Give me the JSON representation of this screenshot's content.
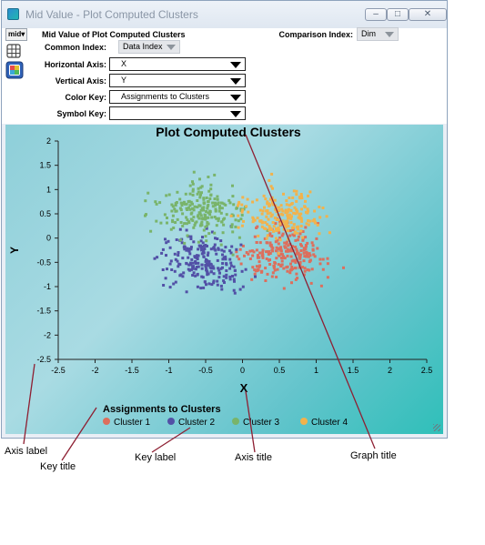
{
  "window": {
    "title": "Mid Value - Plot Computed Clusters",
    "buttons": [
      "–",
      "□",
      "✕"
    ]
  },
  "toolbar": {
    "mid_label": "mid▾",
    "header": "Mid Value of Plot Computed Clusters",
    "comparison_index_label": "Comparison Index:",
    "comparison_index_value": "Dim",
    "common_index_label": "Common Index:",
    "common_index_value": "Data Index",
    "horizontal_axis_label": "Horizontal Axis:",
    "horizontal_axis_value": "X",
    "vertical_axis_label": "Vertical Axis:",
    "vertical_axis_value": "Y",
    "color_key_label": "Color Key:",
    "color_key_value": "Assignments to Clusters",
    "symbol_key_label": "Symbol Key:",
    "symbol_key_value": ""
  },
  "chart_data": {
    "type": "scatter",
    "title": "Plot Computed Clusters",
    "xlabel": "X",
    "ylabel": "Y",
    "xlim": [
      -2.5,
      2.5
    ],
    "ylim": [
      -2.5,
      2
    ],
    "xticks": [
      "-2.5",
      "-2",
      "-1.5",
      "-1",
      "-0.5",
      "0",
      "0.5",
      "1",
      "1.5",
      "2",
      "2.5"
    ],
    "yticks": [
      "2",
      "1.5",
      "1",
      "0.5",
      "0",
      "-0.5",
      "-1",
      "-1.5",
      "-2",
      "-2.5"
    ],
    "legend_title": "Assignments to Clusters",
    "legend_position": "bottom",
    "grid": false,
    "series": [
      {
        "name": "Cluster 1",
        "color": "#dd6e5c",
        "center": [
          0.55,
          -0.35
        ],
        "spread": [
          0.42,
          0.38
        ],
        "count": 240
      },
      {
        "name": "Cluster 2",
        "color": "#5250a6",
        "center": [
          -0.55,
          -0.45
        ],
        "spread": [
          0.4,
          0.38
        ],
        "count": 230
      },
      {
        "name": "Cluster 3",
        "color": "#79b46a",
        "center": [
          -0.55,
          0.55
        ],
        "spread": [
          0.4,
          0.4
        ],
        "count": 220
      },
      {
        "name": "Cluster 4",
        "color": "#f2b24c",
        "center": [
          0.55,
          0.5
        ],
        "spread": [
          0.38,
          0.38
        ],
        "count": 200
      }
    ]
  },
  "annotations": {
    "axis_label": "Axis label",
    "key_title": "Key title",
    "key_label": "Key label",
    "axis_title": "Axis title",
    "graph_title": "Graph title"
  }
}
